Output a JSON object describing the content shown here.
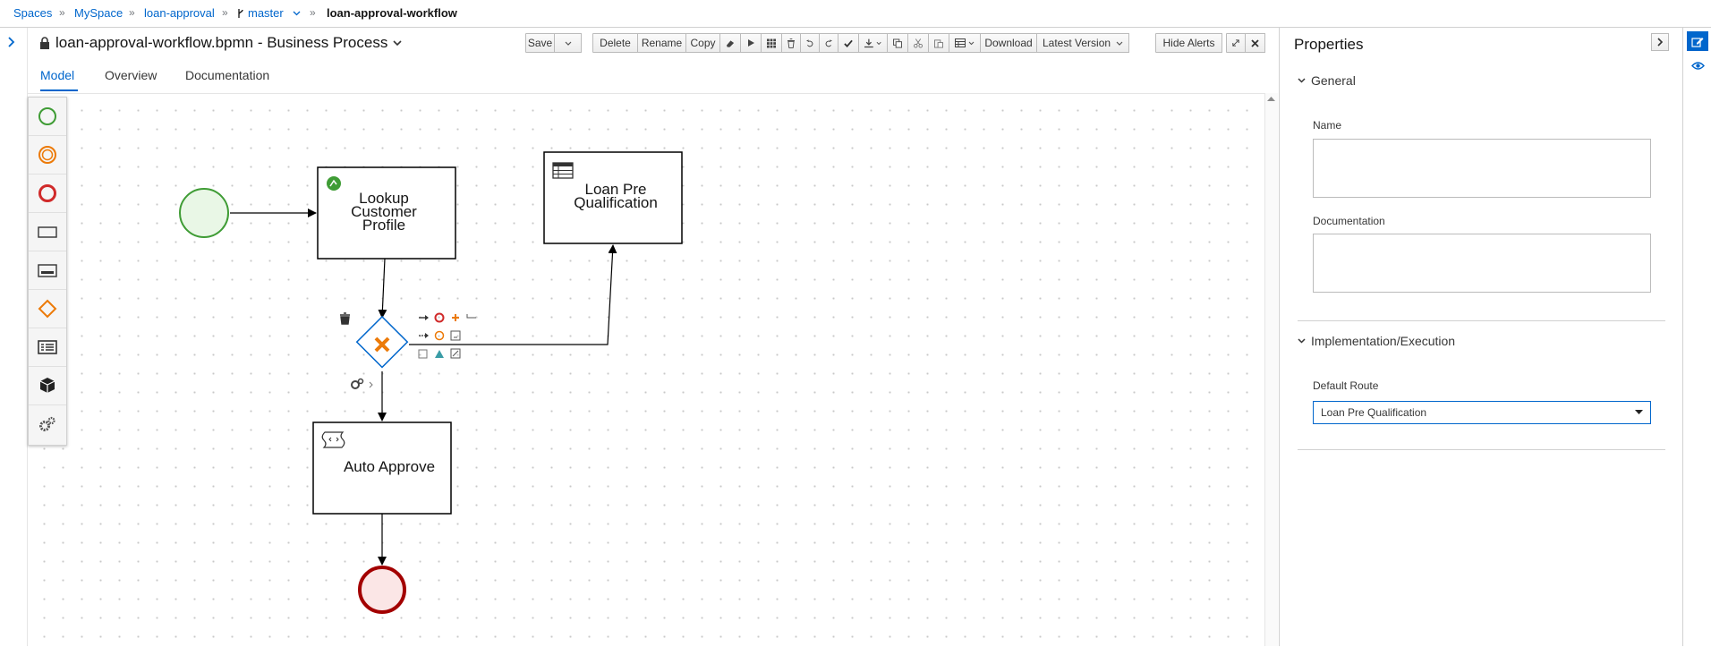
{
  "breadcrumb": {
    "spaces": "Spaces",
    "space": "MySpace",
    "project": "loan-approval",
    "branch": "master",
    "asset": "loan-approval-workflow"
  },
  "editor": {
    "title": "loan-approval-workflow.bpmn - Business Process"
  },
  "toolbar": {
    "save": "Save",
    "delete": "Delete",
    "rename": "Rename",
    "copy": "Copy",
    "download": "Download",
    "latest_version": "Latest Version",
    "hide_alerts": "Hide Alerts"
  },
  "tabs": {
    "model": "Model",
    "overview": "Overview",
    "documentation": "Documentation"
  },
  "diagram": {
    "task_lookup_line1": "Lookup",
    "task_lookup_line2": "Customer",
    "task_lookup_line3": "Profile",
    "task_preq_line1": "Loan Pre",
    "task_preq_line2": "Qualification",
    "task_auto": "Auto Approve"
  },
  "properties": {
    "title": "Properties",
    "general": "General",
    "name_label": "Name",
    "documentation_label": "Documentation",
    "impl_section": "Implementation/Execution",
    "default_route_label": "Default Route",
    "default_route_value": "Loan Pre Qualification"
  },
  "colors": {
    "accent": "#0066cc",
    "start_event": "#3f9c35",
    "end_event": "#a30000",
    "gateway": "#ec7a08"
  }
}
